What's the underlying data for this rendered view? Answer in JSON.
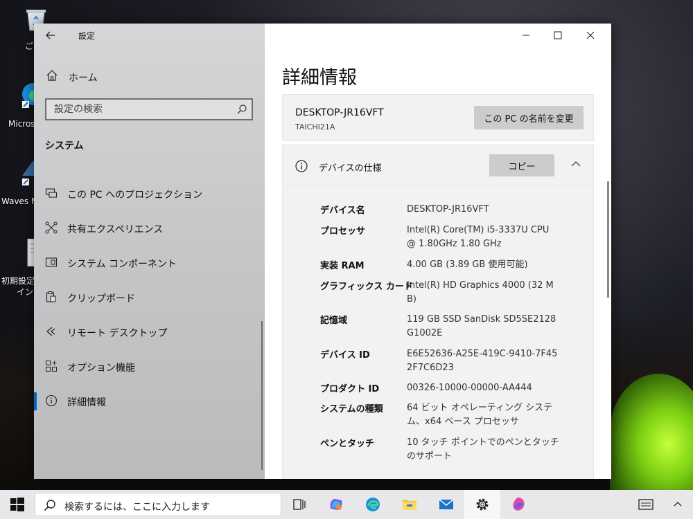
{
  "desktop": {
    "icons": [
      {
        "label": "ご",
        "icon": "recycle-bin-icon"
      },
      {
        "label": "Micros",
        "icon": "edge-shortcut-icon"
      },
      {
        "label": "Waves M",
        "icon": "waves-shortcut-icon"
      },
      {
        "label": "初期設定",
        "label2": "イン",
        "icon": "document-icon"
      }
    ]
  },
  "window": {
    "app_title": "設定",
    "controls": {
      "minimize": "—",
      "maximize": "☐",
      "close": "✕"
    }
  },
  "nav": {
    "home_label": "ホーム",
    "search_placeholder": "設定の検索",
    "section_label": "システム",
    "items": [
      {
        "label": "この PC へのプロジェクション",
        "icon": "projection-icon"
      },
      {
        "label": "共有エクスペリエンス",
        "icon": "shared-experience-icon"
      },
      {
        "label": "システム コンポーネント",
        "icon": "system-components-icon"
      },
      {
        "label": "クリップボード",
        "icon": "clipboard-icon"
      },
      {
        "label": "リモート デスクトップ",
        "icon": "remote-desktop-icon"
      },
      {
        "label": "オプション機能",
        "icon": "optional-features-icon"
      },
      {
        "label": "詳細情報",
        "icon": "info-icon",
        "active": true
      }
    ]
  },
  "content": {
    "title": "詳細情報",
    "pc_name": "DESKTOP-JR16VFT",
    "pc_model": "TAICHI21A",
    "rename_label": "この PC の名前を変更",
    "spec_heading": "デバイスの仕様",
    "copy_label": "コピー",
    "specs": [
      {
        "key": "デバイス名",
        "value": "DESKTOP-JR16VFT"
      },
      {
        "key": "プロセッサ",
        "value": "Intel(R) Core(TM) i5-3337U CPU @ 1.80GHz 1.80 GHz"
      },
      {
        "key": "実装 RAM",
        "value": "4.00 GB (3.89 GB 使用可能)"
      },
      {
        "key": "グラフィックス カード",
        "value": "Intel(R) HD Graphics 4000 (32 MB)"
      },
      {
        "key": "記憶域",
        "value": "119 GB SSD SanDisk SD5SE2128G1002E"
      },
      {
        "key": "デバイス ID",
        "value": "E6E52636-A25E-419C-9410-7F452F7C6D23"
      },
      {
        "key": "プロダクト ID",
        "value": "00326-10000-00000-AA444"
      },
      {
        "key": "システムの種類",
        "value": "64 ビット オペレーティング システム、x64 ベース プロセッサ"
      },
      {
        "key": "ペンとタッチ",
        "value": "10 タッチ ポイントでのペンとタッチのサポート"
      }
    ]
  },
  "taskbar": {
    "search_placeholder": "検索するには、ここに入力します",
    "apps": [
      {
        "name": "task-view",
        "icon": "task-view-icon"
      },
      {
        "name": "copilot",
        "icon": "copilot-icon"
      },
      {
        "name": "edge",
        "icon": "edge-icon"
      },
      {
        "name": "file-explorer",
        "icon": "folder-icon"
      },
      {
        "name": "mail",
        "icon": "mail-icon"
      },
      {
        "name": "settings",
        "icon": "gear-icon",
        "active": true
      },
      {
        "name": "paint",
        "icon": "paint-icon"
      }
    ]
  },
  "colors": {
    "accent": "#0067c0",
    "button_gray": "#cccccc",
    "panel_gray": "#f2f2f2"
  }
}
